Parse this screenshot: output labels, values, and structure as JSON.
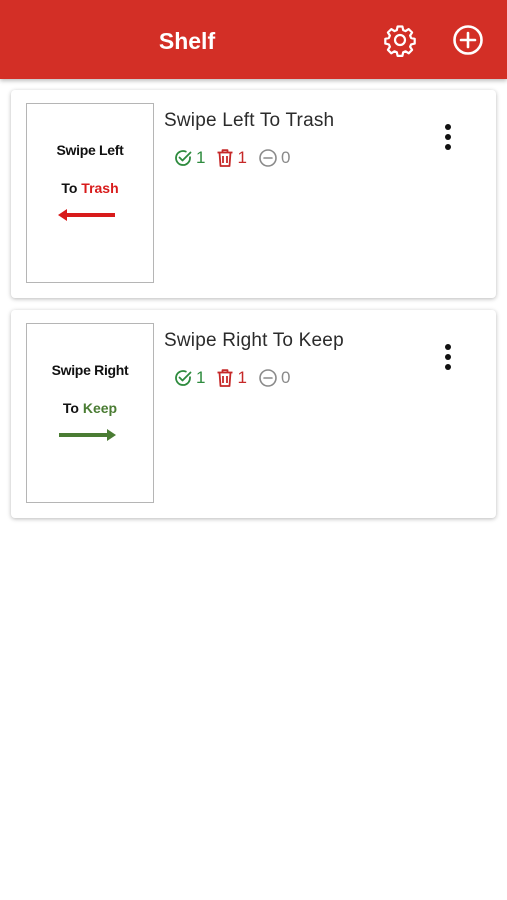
{
  "appbar": {
    "title": "Shelf",
    "color": "#d32f26",
    "settings_icon": "gear-icon",
    "add_icon": "plus-circle-icon"
  },
  "cards": [
    {
      "title": "Swipe Left To Trash",
      "thumbnail": {
        "line1": "Swipe Left",
        "line2_prefix": "To ",
        "line2_accent": "Trash",
        "accent_color": "#d81b1b",
        "arrow": "arrow-left"
      },
      "stats": {
        "keep": "1",
        "trash": "1",
        "skip": "0"
      }
    },
    {
      "title": "Swipe Right To Keep",
      "thumbnail": {
        "line1": "Swipe Right",
        "line2_prefix": "To ",
        "line2_accent": "Keep",
        "accent_color": "#4a7c33",
        "arrow": "arrow-right"
      },
      "stats": {
        "keep": "1",
        "trash": "1",
        "skip": "0"
      }
    }
  ],
  "colors": {
    "keep": "#2e8b3e",
    "trash": "#c62828",
    "skip": "#8a8a8a"
  }
}
